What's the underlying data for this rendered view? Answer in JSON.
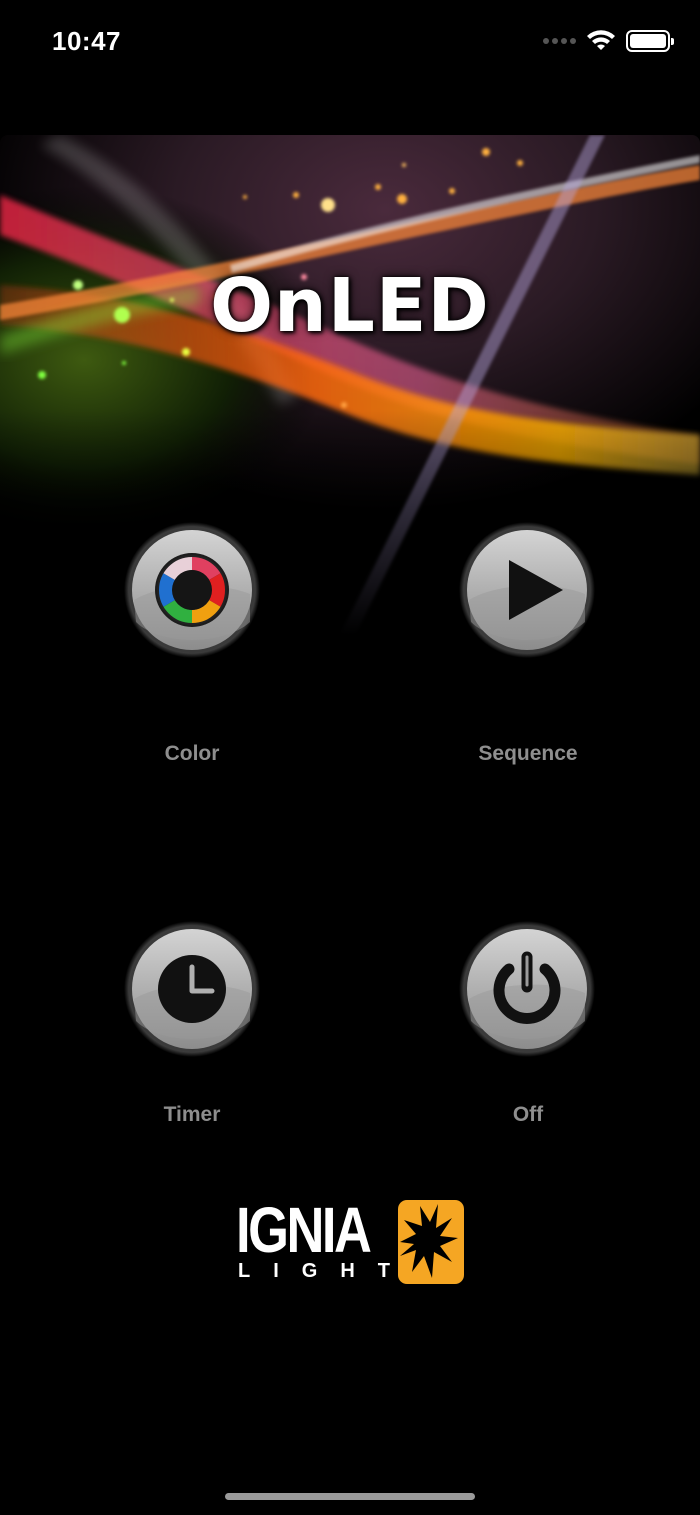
{
  "status_bar": {
    "time": "10:47"
  },
  "hero": {
    "title": "OnLED"
  },
  "buttons": [
    {
      "label": "Color",
      "icon": "color-wheel-icon"
    },
    {
      "label": "Sequence",
      "icon": "play-icon"
    },
    {
      "label": "Timer",
      "icon": "clock-icon"
    },
    {
      "label": "Off",
      "icon": "power-icon"
    }
  ],
  "footer": {
    "logo_word": "IGNIA",
    "logo_sub": "LIGHT"
  },
  "colors": {
    "background": "#000000",
    "label": "#8e8e8e",
    "logo_accent": "#f5a623"
  }
}
